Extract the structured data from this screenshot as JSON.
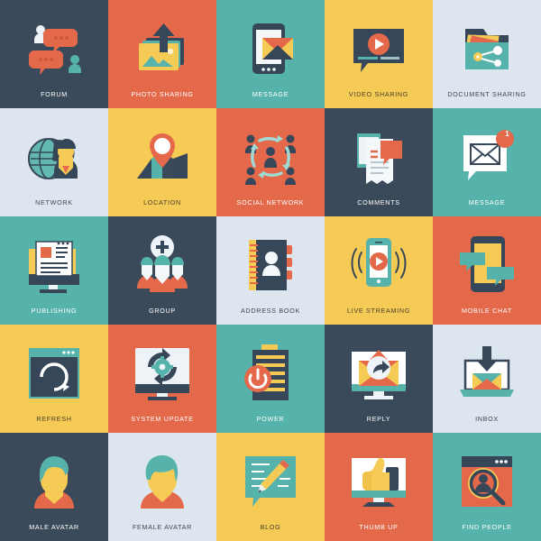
{
  "grid": {
    "columns": 5,
    "rows": 5,
    "tile_size": 120,
    "palette": {
      "dark": "#3b4a5a",
      "orange": "#e4684a",
      "teal": "#56b3ab",
      "yellow": "#f5cb55",
      "light": "#dde5ee",
      "white": "#ffffff",
      "deep_navy": "#37475a",
      "sand": "#f0c14b"
    }
  },
  "tiles": [
    {
      "label": "FORUM",
      "icon": "forum-icon",
      "bg": "dark",
      "label_class": "lbl-ondark"
    },
    {
      "label": "PHOTO SHARING",
      "icon": "photo-sharing-icon",
      "bg": "orange",
      "label_class": "lbl-onorange"
    },
    {
      "label": "MESSAGE",
      "icon": "message-tablet-icon",
      "bg": "teal",
      "label_class": "lbl-onteal"
    },
    {
      "label": "VIDEO SHARING",
      "icon": "video-sharing-icon",
      "bg": "yellow",
      "label_class": "lbl-onyellow"
    },
    {
      "label": "DOCUMENT SHARING",
      "icon": "document-sharing-icon",
      "bg": "light",
      "label_class": "lbl-onlight"
    },
    {
      "label": "NETWORK",
      "icon": "network-globe-icon",
      "bg": "light",
      "label_class": "lbl-onlight"
    },
    {
      "label": "LOCATION",
      "icon": "location-pin-icon",
      "bg": "yellow",
      "label_class": "lbl-onyellow"
    },
    {
      "label": "SOCIAL NETWORK",
      "icon": "social-network-icon",
      "bg": "orange",
      "label_class": "lbl-onorange"
    },
    {
      "label": "COMMENTS",
      "icon": "comments-icon",
      "bg": "dark",
      "label_class": "lbl-ondark"
    },
    {
      "label": "MESSAGE",
      "icon": "message-badge-icon",
      "bg": "teal",
      "label_class": "lbl-onteal",
      "badge": "1"
    },
    {
      "label": "PUBLISHING",
      "icon": "publishing-icon",
      "bg": "teal",
      "label_class": "lbl-onteal"
    },
    {
      "label": "GROUP",
      "icon": "group-add-icon",
      "bg": "dark",
      "label_class": "lbl-ondark"
    },
    {
      "label": "ADDRESS BOOK",
      "icon": "address-book-icon",
      "bg": "light",
      "label_class": "lbl-onlight"
    },
    {
      "label": "LIVE STREAMING",
      "icon": "live-streaming-icon",
      "bg": "yellow",
      "label_class": "lbl-onyellow"
    },
    {
      "label": "MOBILE CHAT",
      "icon": "mobile-chat-icon",
      "bg": "orange",
      "label_class": "lbl-onorange"
    },
    {
      "label": "REFRESH",
      "icon": "refresh-icon",
      "bg": "yellow",
      "label_class": "lbl-onyellow"
    },
    {
      "label": "SYSTEM UPDATE",
      "icon": "system-update-icon",
      "bg": "orange",
      "label_class": "lbl-onorange"
    },
    {
      "label": "POWER",
      "icon": "power-icon",
      "bg": "teal",
      "label_class": "lbl-onteal"
    },
    {
      "label": "REPLY",
      "icon": "reply-icon",
      "bg": "dark",
      "label_class": "lbl-ondark"
    },
    {
      "label": "INBOX",
      "icon": "inbox-icon",
      "bg": "light",
      "label_class": "lbl-onlight"
    },
    {
      "label": "MALE AVATAR",
      "icon": "male-avatar-icon",
      "bg": "dark",
      "label_class": "lbl-ondark"
    },
    {
      "label": "FEMALE AVATAR",
      "icon": "female-avatar-icon",
      "bg": "light",
      "label_class": "lbl-onlight"
    },
    {
      "label": "BLOG",
      "icon": "blog-icon",
      "bg": "yellow",
      "label_class": "lbl-onyellow"
    },
    {
      "label": "THUMB UP",
      "icon": "thumb-up-icon",
      "bg": "orange",
      "label_class": "lbl-onorange"
    },
    {
      "label": "FIND PEOPLE",
      "icon": "find-people-icon",
      "bg": "teal",
      "label_class": "lbl-onteal"
    }
  ]
}
